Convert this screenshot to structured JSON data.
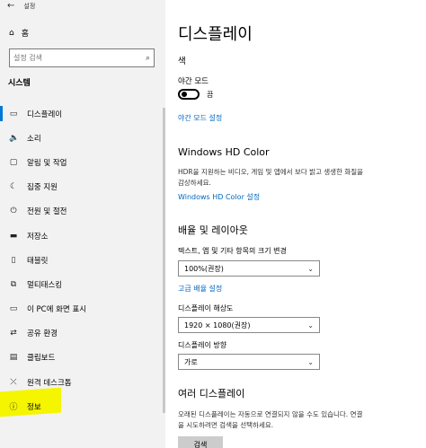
{
  "window": {
    "title": "설정",
    "back_icon": "back-arrow-icon"
  },
  "sidebar": {
    "home_label": "홈",
    "search_placeholder": "설정 검색",
    "section_title": "시스템",
    "items": [
      {
        "label": "디스플레이",
        "icon": "monitor-icon",
        "active": true
      },
      {
        "label": "소리",
        "icon": "speaker-icon"
      },
      {
        "label": "알림 및 작업",
        "icon": "notification-icon"
      },
      {
        "label": "집중 지원",
        "icon": "moon-icon"
      },
      {
        "label": "전원 및 절전",
        "icon": "power-icon"
      },
      {
        "label": "저장소",
        "icon": "storage-icon"
      },
      {
        "label": "태블릿",
        "icon": "tablet-icon"
      },
      {
        "label": "멀티태스킹",
        "icon": "multitasking-icon"
      },
      {
        "label": "이 PC에 화면 표시",
        "icon": "project-icon"
      },
      {
        "label": "공유 환경",
        "icon": "share-icon"
      },
      {
        "label": "클립보드",
        "icon": "clipboard-icon"
      },
      {
        "label": "원격 데스크톱",
        "icon": "remote-desktop-icon"
      },
      {
        "label": "정보",
        "icon": "info-icon"
      }
    ]
  },
  "main": {
    "title": "디스플레이",
    "color_heading": "색",
    "night_light_label": "야간 모드",
    "night_light_state": "끔",
    "night_light_settings_link": "야간 모드 설정",
    "hd_color_heading": "Windows HD Color",
    "hd_color_desc_1": "HDR을 지원하는 비디오, 게임 및 앱에서 보다 밝고 생생한 화질을",
    "hd_color_desc_2": "감상하세요.",
    "hd_color_link": "Windows HD Color 설정",
    "scale_heading": "배율 및 레이아웃",
    "scale_label": "텍스트, 앱 및 기타 항목의 크기 변경",
    "scale_value": "100%(권장)",
    "advanced_scale_link": "고급 배율 설정",
    "resolution_label": "디스플레이 해상도",
    "resolution_value": "1920 × 1080(권장)",
    "orientation_label": "디스플레이 방향",
    "orientation_value": "가로",
    "multi_heading": "여러 디스플레이",
    "multi_desc_1": "오래된 디스플레이는 자동으로 연결되지 않을 수도 있습니다. 연결",
    "multi_desc_2": "을 시도하려면 검색을 선택하세요.",
    "detect_button": "검색"
  },
  "colors": {
    "accent": "#0067c0",
    "highlight": "#f5f500",
    "sidebar_bg": "#f2f2f2"
  }
}
